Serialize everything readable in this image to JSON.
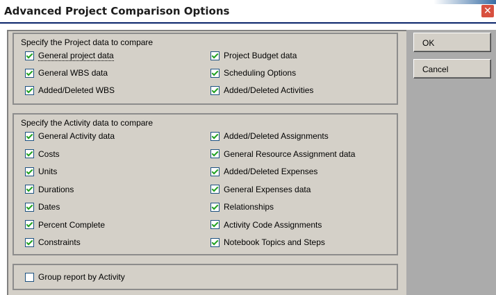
{
  "window": {
    "title": "Advanced Project Comparison Options"
  },
  "buttons": {
    "ok": "OK",
    "cancel": "Cancel"
  },
  "project_group": {
    "title": "Specify the Project data to compare",
    "left": [
      {
        "label": "General project data",
        "checked": true
      },
      {
        "label": "General WBS data",
        "checked": true
      },
      {
        "label": "Added/Deleted WBS",
        "checked": true
      }
    ],
    "right": [
      {
        "label": "Project Budget data",
        "checked": true
      },
      {
        "label": "Scheduling Options",
        "checked": true
      },
      {
        "label": "Added/Deleted Activities",
        "checked": true
      }
    ]
  },
  "activity_group": {
    "title": "Specify the Activity data to compare",
    "left": [
      {
        "label": "General Activity data",
        "checked": true
      },
      {
        "label": "Costs",
        "checked": true
      },
      {
        "label": "Units",
        "checked": true
      },
      {
        "label": "Durations",
        "checked": true
      },
      {
        "label": "Dates",
        "checked": true
      },
      {
        "label": "Percent Complete",
        "checked": true
      },
      {
        "label": "Constraints",
        "checked": true
      }
    ],
    "right": [
      {
        "label": "Added/Deleted Assignments",
        "checked": true
      },
      {
        "label": "General Resource Assignment data",
        "checked": true
      },
      {
        "label": "Added/Deleted Expenses",
        "checked": true
      },
      {
        "label": "General Expenses data",
        "checked": true
      },
      {
        "label": "Relationships",
        "checked": true
      },
      {
        "label": "Activity Code Assignments",
        "checked": true
      },
      {
        "label": "Notebook Topics and Steps",
        "checked": true
      }
    ]
  },
  "group_report": {
    "label": "Group report by Activity",
    "checked": false
  }
}
